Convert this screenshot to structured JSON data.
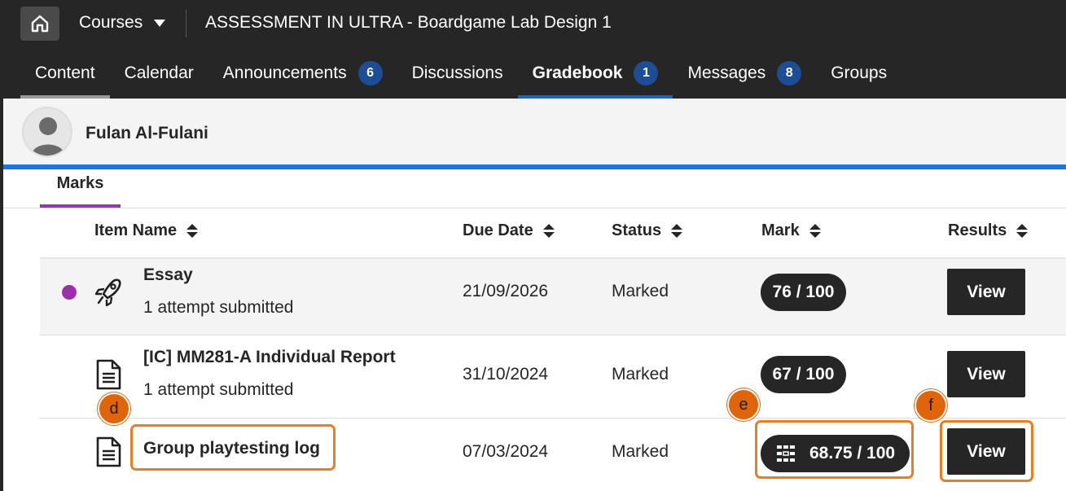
{
  "header": {
    "courses_label": "Courses",
    "course_title": "ASSESSMENT IN ULTRA - Boardgame Lab Design 1"
  },
  "tabs": [
    {
      "label": "Content",
      "badge": null
    },
    {
      "label": "Calendar",
      "badge": null
    },
    {
      "label": "Announcements",
      "badge": "6"
    },
    {
      "label": "Discussions",
      "badge": null
    },
    {
      "label": "Gradebook",
      "badge": "1"
    },
    {
      "label": "Messages",
      "badge": "8"
    },
    {
      "label": "Groups",
      "badge": null
    }
  ],
  "active_tab": "Gradebook",
  "student": {
    "name": "Fulan Al-Fulani"
  },
  "subtab": {
    "label": "Marks"
  },
  "columns": {
    "item_name": "Item Name",
    "due_date": "Due Date",
    "status": "Status",
    "mark": "Mark",
    "results": "Results"
  },
  "rows": [
    {
      "title": "Essay",
      "subtitle": "1 attempt submitted",
      "due": "21/09/2026",
      "status": "Marked",
      "mark": "76 / 100",
      "action": "View",
      "icon": "rocket-icon"
    },
    {
      "title": "[IC] MM281-A Individual Report",
      "subtitle": "1 attempt submitted",
      "due": "31/10/2024",
      "status": "Marked",
      "mark": "67 / 100",
      "action": "View",
      "icon": "document-icon"
    },
    {
      "title": "Group playtesting log",
      "subtitle": "",
      "due": "07/03/2024",
      "status": "Marked",
      "mark": "68.75 / 100",
      "action": "View",
      "icon": "document-icon"
    }
  ],
  "callouts": {
    "d": "d",
    "e": "e",
    "f": "f"
  },
  "colors": {
    "topbar": "#262626",
    "active_tab_underline": "#1c61c4",
    "badge": "#1d4d94",
    "marks_underline": "#8e3aac",
    "new_dot": "#9b2fae",
    "callout": "#e0640a",
    "highlight_outline": "#e87e21"
  }
}
